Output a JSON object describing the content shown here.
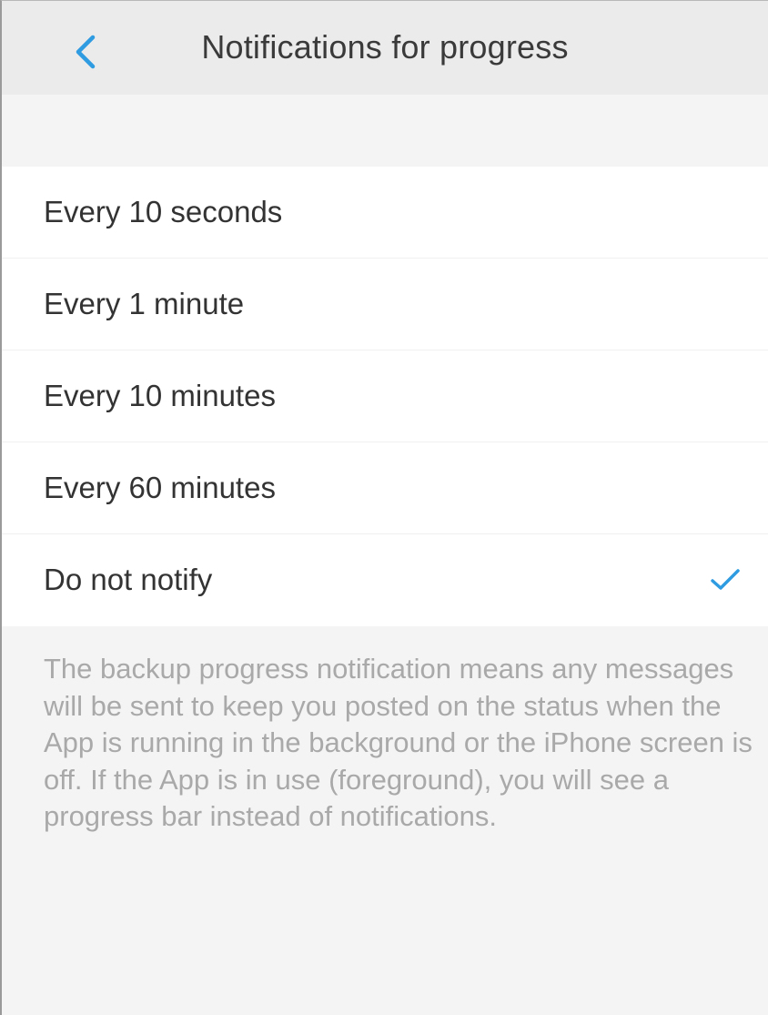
{
  "navbar": {
    "title": "Notifications for progress",
    "back_icon": "chevron-left-icon",
    "accent_color": "#2f9be0"
  },
  "options": [
    {
      "label": "Every 10 seconds",
      "selected": false
    },
    {
      "label": "Every 1 minute",
      "selected": false
    },
    {
      "label": "Every 10 minutes",
      "selected": false
    },
    {
      "label": "Every 60 minutes",
      "selected": false
    },
    {
      "label": "Do not notify",
      "selected": true
    }
  ],
  "selected_icon": "checkmark-icon",
  "footer": {
    "note": "The backup progress notification means any messages will be sent to keep you posted on the status when the App is running in the background or the iPhone screen is off. If the App is in use (foreground), you will see a progress bar instead of notifications."
  }
}
